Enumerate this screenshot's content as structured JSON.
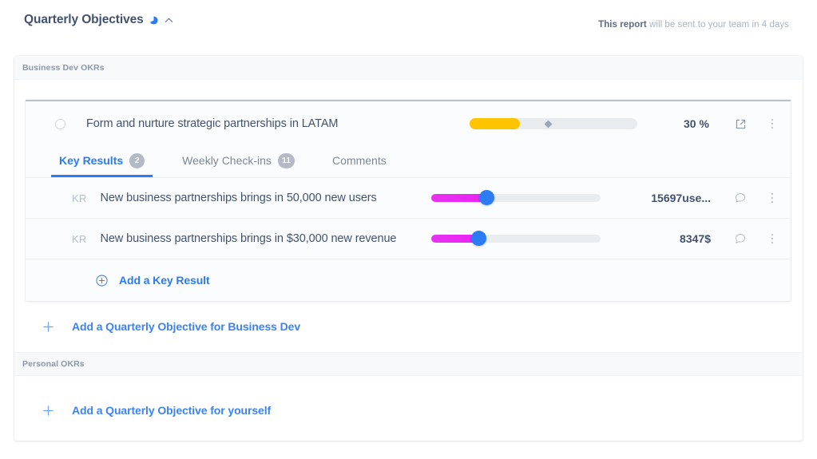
{
  "header": {
    "title": "Quarterly Objectives",
    "pie_icon": "pie-chart-icon",
    "collapse_icon": "chevron-up-icon",
    "note_bold": "This report",
    "note_rest": " will be sent to your team in 4 days"
  },
  "groups": [
    {
      "label": "Business Dev OKRs",
      "objective": {
        "title": "Form and nurture strategic partnerships in LATAM",
        "progress_percent": 30,
        "progress_label": "30",
        "progress_unit": "%",
        "progress_color": "#ffc400",
        "marker_percent": 47,
        "open_icon": "external-link-icon",
        "menu_icon": "kebab-menu-icon",
        "tabs": [
          {
            "label": "Key Results",
            "badge": "2",
            "active": true
          },
          {
            "label": "Weekly Check-ins",
            "badge": "11",
            "active": false
          },
          {
            "label": "Comments",
            "badge": "",
            "active": false
          }
        ],
        "key_results": [
          {
            "tag": "KR",
            "title": "New business partnerships brings in 50,000 new users",
            "progress_percent": 33,
            "value": "15697",
            "unit": "use...",
            "comment_icon": "comment-bubble-icon",
            "menu_icon": "kebab-menu-icon"
          },
          {
            "tag": "KR",
            "title": "New business partnerships brings in $30,000 new revenue",
            "progress_percent": 28,
            "value": "8347",
            "unit": "$",
            "comment_icon": "comment-bubble-icon",
            "menu_icon": "kebab-menu-icon"
          }
        ],
        "add_key_result": {
          "icon": "circle-plus-icon",
          "label": "Add a Key Result"
        }
      },
      "add_objective": {
        "icon": "plus-icon",
        "label": "Add a Quarterly Objective for Business Dev"
      }
    },
    {
      "label": "Personal OKRs",
      "add_objective": {
        "icon": "plus-icon",
        "label": "Add a Quarterly Objective for yourself"
      }
    }
  ],
  "colors": {
    "accent_blue": "#2b7bf3",
    "objective_amber": "#ffc400",
    "kr_magenta": "#ea22f5",
    "text_primary": "#42526e",
    "text_muted": "#b3bdc9"
  }
}
